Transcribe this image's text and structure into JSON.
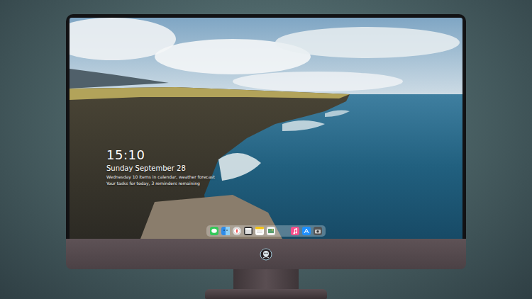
{
  "lock_screen": {
    "time": "15:10",
    "date": "Sunday September 28",
    "notes": [
      "Wednesday 10 items in calendar, weather forecast",
      "Your tasks for today, 3 reminders remaining"
    ]
  }
}
